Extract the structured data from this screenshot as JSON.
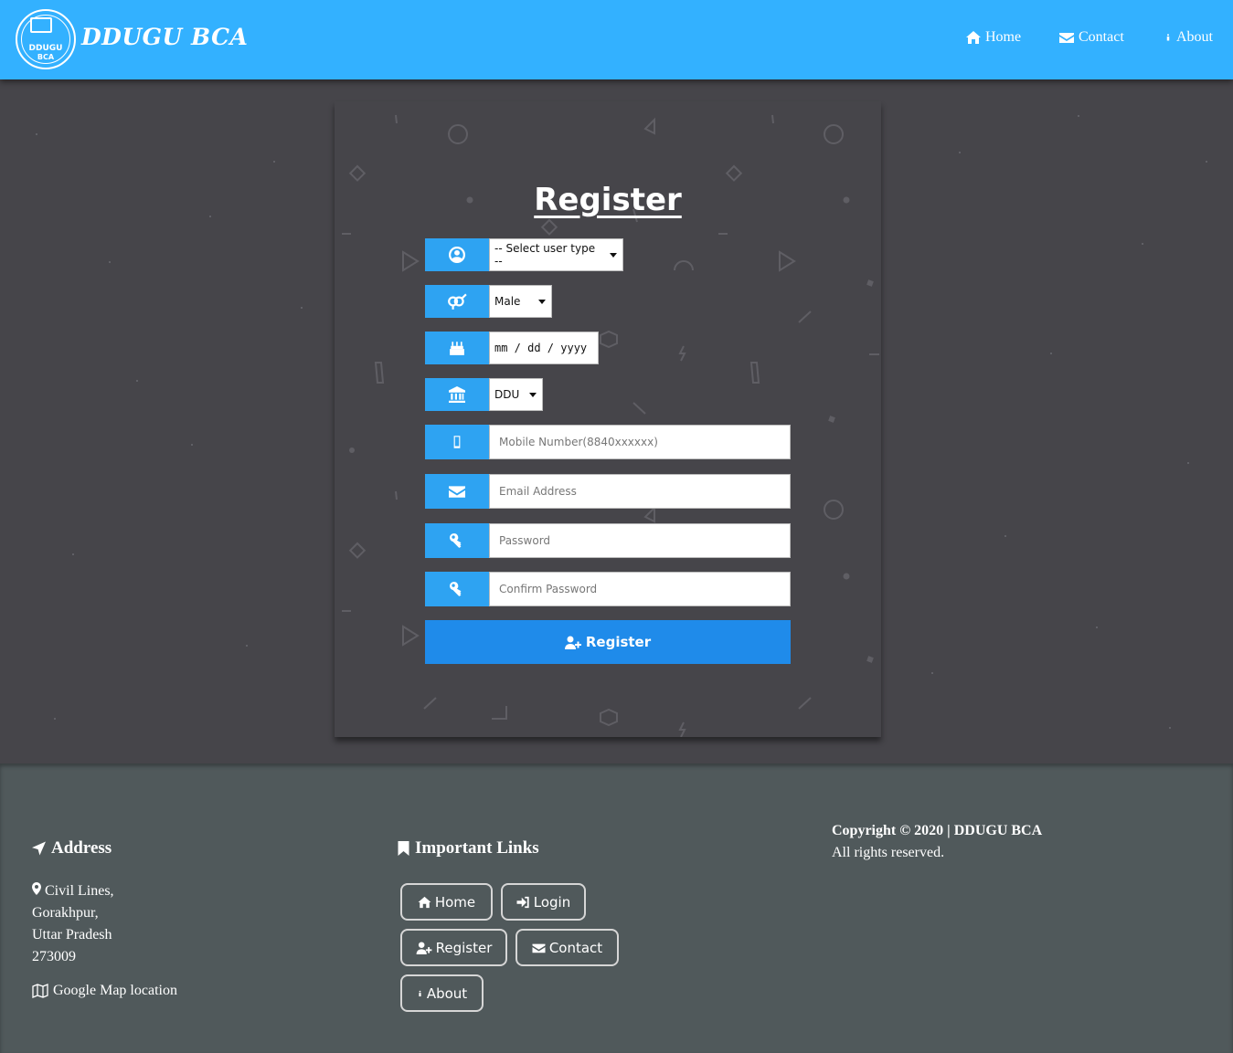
{
  "nav": {
    "logo_line1": "DDUGU",
    "logo_line2": "BCA",
    "brand": "DDUGU BCA",
    "links": [
      {
        "label": "Home",
        "icon": "home-icon"
      },
      {
        "label": "Contact",
        "icon": "envelope-icon"
      },
      {
        "label": "About",
        "icon": "info-icon"
      }
    ]
  },
  "form": {
    "title": "Register",
    "user_type": {
      "value": "-- Select user type --",
      "icon": "user-circle-icon"
    },
    "gender": {
      "value": "Male",
      "icon": "gender-icon"
    },
    "dob": {
      "value": "mm / dd / yyyy",
      "icon": "birthday-cake-icon"
    },
    "college": {
      "value": "DDU",
      "icon": "university-icon"
    },
    "mobile": {
      "placeholder": "Mobile Number(8840xxxxxx)",
      "icon": "mobile-icon"
    },
    "email": {
      "placeholder": "Email Address",
      "icon": "envelope-icon"
    },
    "password": {
      "placeholder": "Password",
      "icon": "key-icon"
    },
    "confirm_password": {
      "placeholder": "Confirm Password",
      "icon": "key-icon"
    },
    "submit_label": "Register"
  },
  "footer": {
    "address_heading": "Address",
    "address_lines": [
      "Civil Lines,",
      "Gorakhpur,",
      "Uttar Pradesh",
      "273009"
    ],
    "map_link": "Google Map location",
    "links_heading": "Important Links",
    "links": [
      {
        "label": "Home",
        "icon": "home-icon"
      },
      {
        "label": "Login",
        "icon": "sign-in-icon"
      },
      {
        "label": "Register",
        "icon": "user-plus-icon"
      },
      {
        "label": "Contact",
        "icon": "envelope-icon"
      },
      {
        "label": "About",
        "icon": "info-icon"
      }
    ],
    "copyright": "Copyright © 2020 | DDUGU BCA",
    "rights": "All rights reserved."
  },
  "colors": {
    "navbar": "#33b1ff",
    "background": "#46454a",
    "addon": "#2ea3f2",
    "button": "#1f8bea",
    "footer": "#50595b"
  }
}
